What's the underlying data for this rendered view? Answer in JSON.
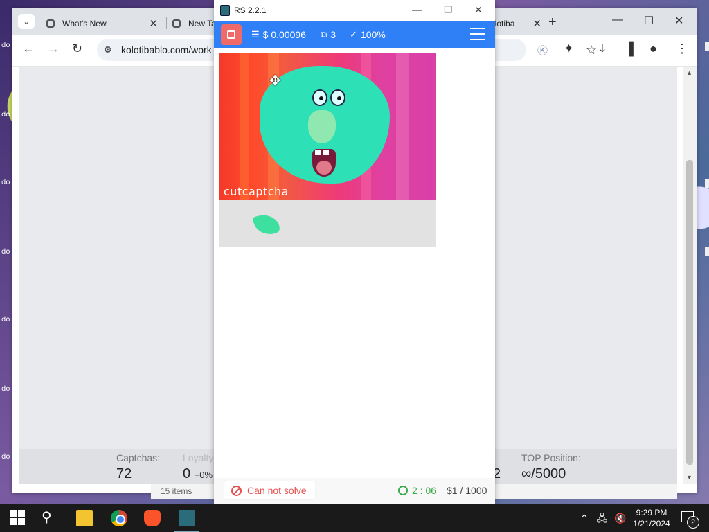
{
  "desktop": {
    "icons": [
      "do",
      "do",
      "do",
      "do",
      "do",
      "do",
      "do"
    ]
  },
  "browser": {
    "tabs": [
      {
        "label": "What's New"
      },
      {
        "label": "New Ta"
      },
      {
        "label": "olotiba"
      }
    ],
    "address": "kolotibablo.com/work",
    "stats": {
      "captchas_label": "Captchas:",
      "captchas_value": "72",
      "loyalty_label": "Loyalty",
      "loyalty_value": "0",
      "loyalty_sub": "+0%",
      "partial_value": "2",
      "top_label": "TOP Position:",
      "top_value": "∞/5000"
    },
    "items_text": "15 items"
  },
  "rs": {
    "title": "RS 2.2.1",
    "balance": "$ 0.00096",
    "images": "3",
    "accuracy": "100%",
    "captcha_logo": "cutcaptcha",
    "cannot_solve": "Can not solve",
    "timer": "2 : 06",
    "rate": "$1 / 1000"
  },
  "taskbar": {
    "time": "9:29 PM",
    "date": "1/21/2024",
    "notifications": "2"
  },
  "colors": {
    "accent_blue": "#2f80f6",
    "stop_red": "#f06a6a",
    "timer_green": "#3aaa4a"
  }
}
